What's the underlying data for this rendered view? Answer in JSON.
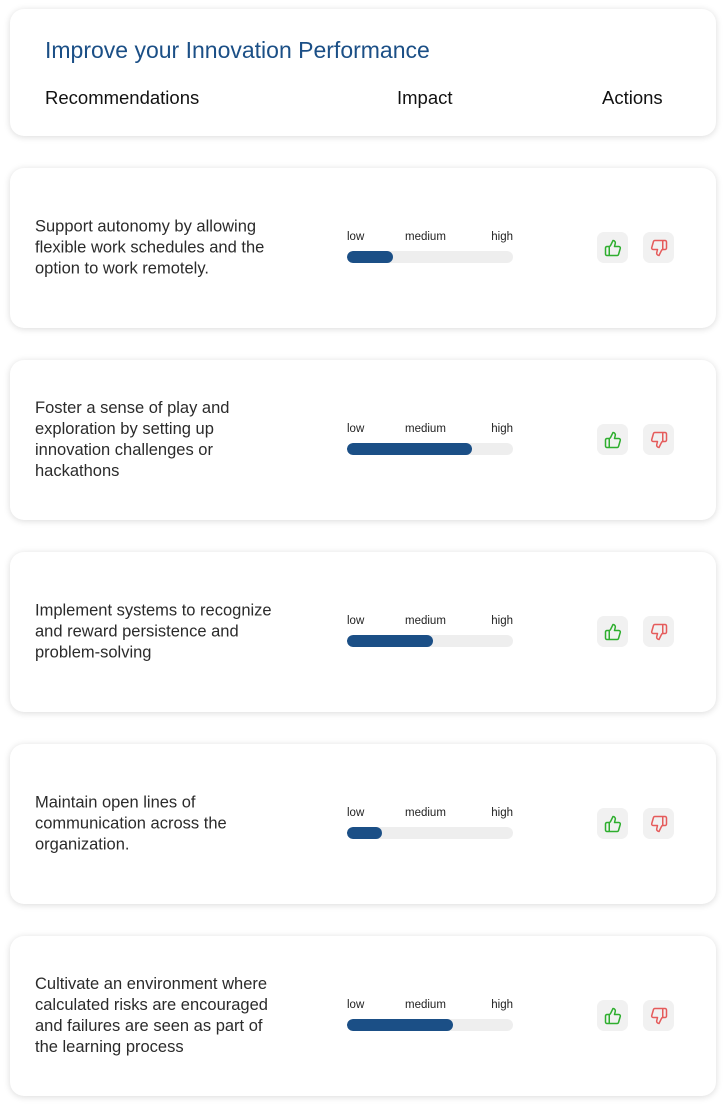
{
  "header": {
    "title": "Improve your Innovation Performance",
    "columns": {
      "recommendations": "Recommendations",
      "impact": "Impact",
      "actions": "Actions"
    }
  },
  "impact_scale": {
    "low": "low",
    "medium": "medium",
    "high": "high"
  },
  "colors": {
    "accent": "#1b4f86",
    "thumbs_up": "#2eae2e",
    "thumbs_down": "#e55b5b"
  },
  "recommendations": [
    {
      "text": "Support autonomy by allowing flexible work schedules and the option to work remotely.",
      "impact_fraction": 0.28
    },
    {
      "text": "Foster a sense of play and exploration by setting up innovation challenges or hackathons",
      "impact_fraction": 0.75
    },
    {
      "text": "Implement systems to recognize and reward persistence and problem-solving",
      "impact_fraction": 0.52
    },
    {
      "text": "Maintain open lines of communication across the organization.",
      "impact_fraction": 0.21
    },
    {
      "text": "Cultivate an environment where calculated risks are encouraged and failures are seen as part of the learning process",
      "impact_fraction": 0.64
    }
  ],
  "icons": {
    "approve": "thumbs-up-icon",
    "reject": "thumbs-down-icon"
  }
}
